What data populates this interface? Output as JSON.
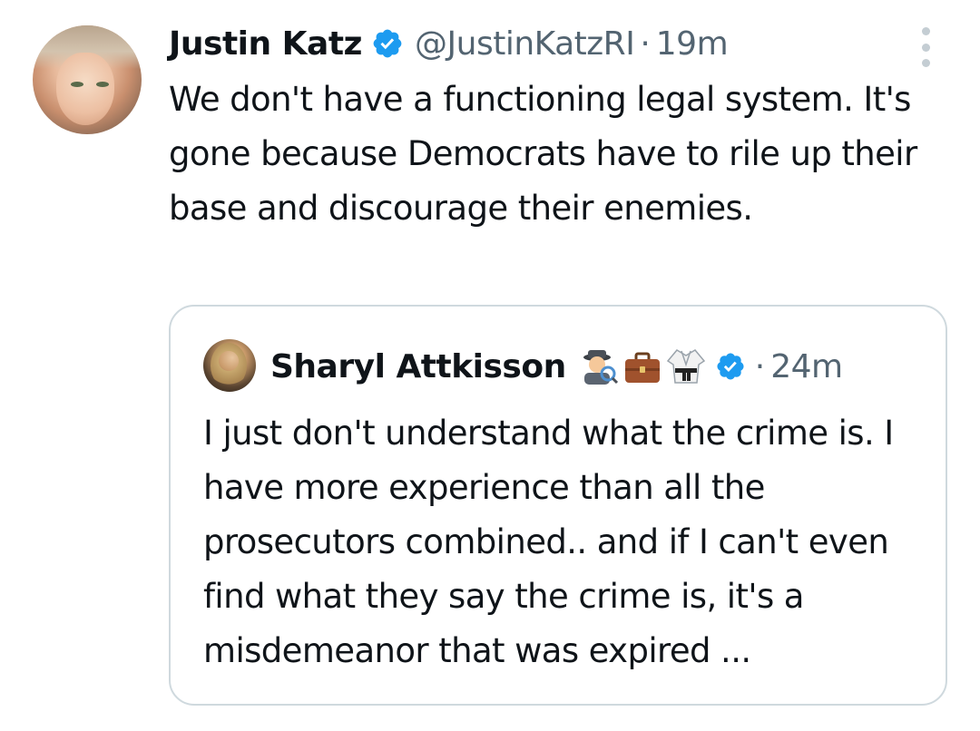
{
  "tweet": {
    "author_name": "Justin Katz",
    "handle": "@JustinKatzRI",
    "separator": "·",
    "time": "19m",
    "text": "We don't have a functioning legal system. It's gone because Democrats have to rile up their base and discourage their enemies."
  },
  "quote": {
    "author_name": "Sharyl Attkisson",
    "emojis": [
      "detective-emoji",
      "briefcase-emoji",
      "martial-arts-uniform-emoji"
    ],
    "separator": "·",
    "time": "24m",
    "text": "I just don't understand what the crime is. I have more experience than all the prosecutors combined.. and if I can't even find what they say the crime is, it's a misdemeanor that was expired ..."
  },
  "colors": {
    "primary_text": "#0f1419",
    "secondary_text": "#536471",
    "verified_blue": "#1d9bf0",
    "border": "#cfd9de",
    "more_dots": "#c4cdd3"
  },
  "icons": {
    "verified": "verified-badge-icon",
    "more": "more-options-icon"
  }
}
